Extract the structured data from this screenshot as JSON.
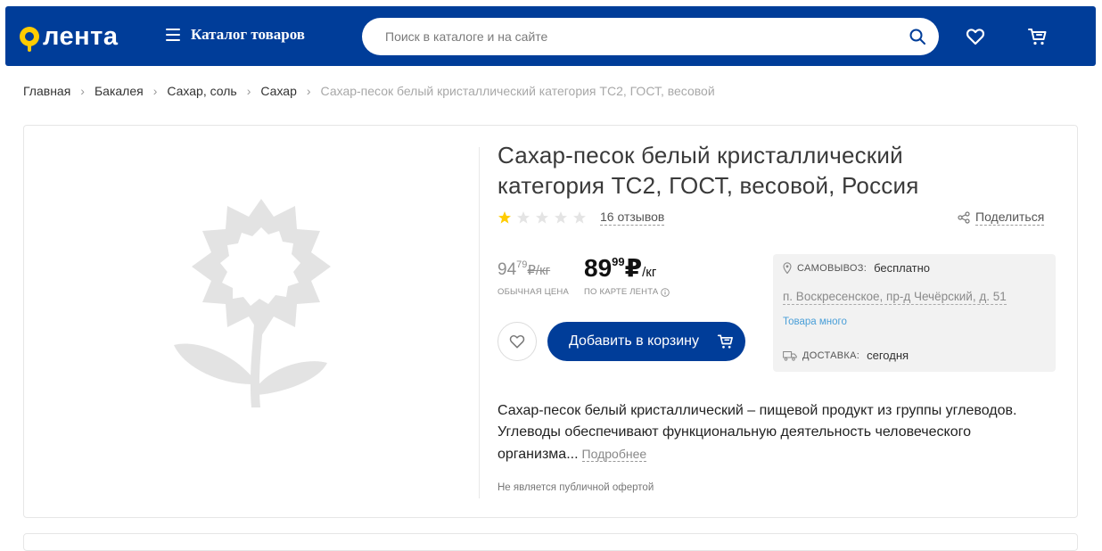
{
  "header": {
    "logo_text": "лента",
    "catalog_label": "Каталог товаров",
    "search_placeholder": "Поиск в каталоге и на сайте",
    "colors": {
      "brand": "#003d99",
      "logo_accent": "#ffcc00"
    }
  },
  "breadcrumb": [
    {
      "label": "Главная"
    },
    {
      "label": "Бакалея"
    },
    {
      "label": "Сахар, соль"
    },
    {
      "label": "Сахар"
    },
    {
      "label": "Сахар-песок белый кристаллический категория ТС2, ГОСТ, весовой"
    }
  ],
  "product": {
    "title": "Сахар-песок белый кристаллический категория ТС2, ГОСТ, весовой, Россия",
    "rating_stars_filled": 1,
    "rating_stars_total": 5,
    "reviews_label": "16 отзывов",
    "share_label": "Поделиться",
    "old_price": {
      "whole": "94",
      "kopecks": "79",
      "unit": "₽/кг",
      "caption": "ОБЫЧНАЯ ЦЕНА"
    },
    "card_price": {
      "whole": "89",
      "kopecks": "99",
      "currency": "₽",
      "per": "/кг",
      "caption": "ПО КАРТЕ ЛЕНТА"
    },
    "add_to_cart_label": "Добавить в корзину",
    "description": "Сахар-песок белый кристаллический – пищевой продукт из группы углеводов. Углеводы обеспечивают функциональную деятельность человеческого организма...",
    "more_label": "Подробнее",
    "offer_note": "Не является публичной офертой"
  },
  "delivery": {
    "pickup_key": "Самовывоз:",
    "pickup_value": "бесплатно",
    "address": "п. Воскресенское, пр-д Чечёрский, д. 51",
    "stock": "Товара много",
    "delivery_key": "Доставка:",
    "delivery_value": "сегодня"
  }
}
